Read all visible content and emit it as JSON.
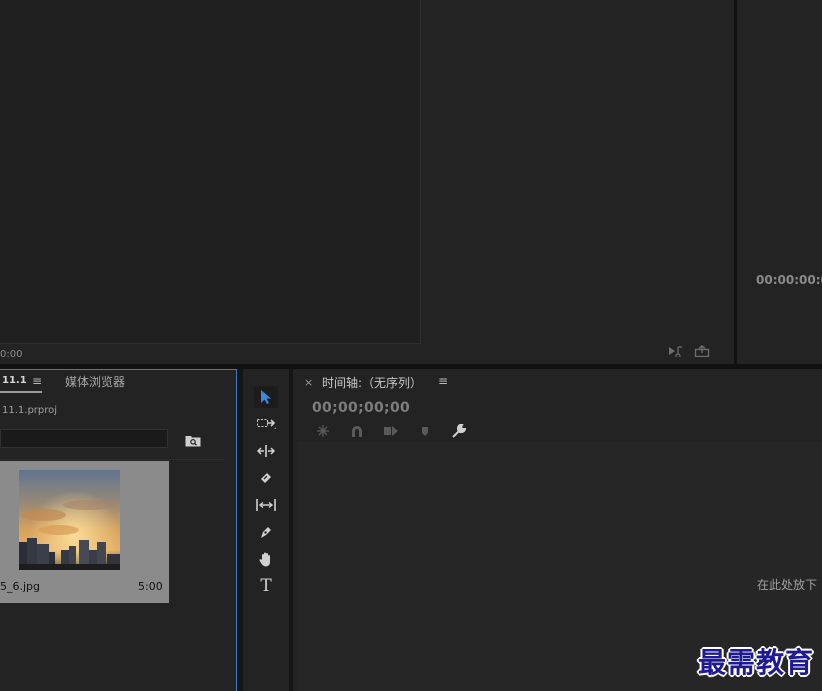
{
  "source_monitor": {
    "timecode": "0:00",
    "icons": [
      "export-frame-icon",
      "insert-icon"
    ]
  },
  "program_monitor": {
    "timecode": "00:00:00:0"
  },
  "project_panel": {
    "tab_label": "11.1",
    "menu_glyph": "≡",
    "media_browser_tab": "媒体浏览器",
    "project_file": "11.1.prproj",
    "item": {
      "name": "5_6.jpg",
      "duration": "5:00"
    }
  },
  "tools": [
    "selection-tool",
    "track-select-tool",
    "ripple-edit-tool",
    "razor-tool",
    "slip-tool",
    "pen-tool",
    "hand-tool",
    "type-tool"
  ],
  "timeline": {
    "close_glyph": "×",
    "title": "时间轴:（无序列）",
    "menu_glyph": "≡",
    "timecode": "00;00;00;00",
    "drop_hint": "在此处放下",
    "type_tool_glyph": "T"
  },
  "watermark": "最需教育",
  "colors": {
    "accent_blue": "#3b78c7",
    "panel_bg": "#232323",
    "watermark": "#1e1a93"
  }
}
